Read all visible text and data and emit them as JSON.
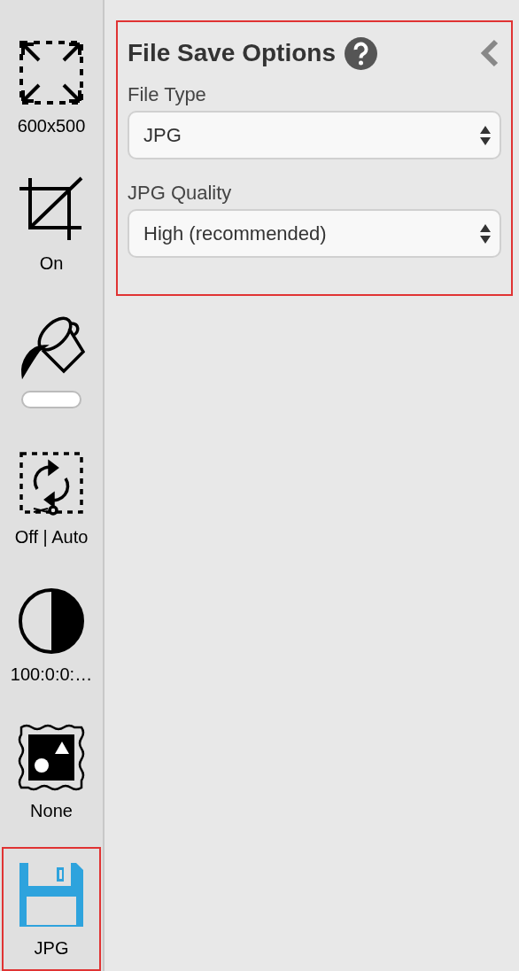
{
  "sidebar": {
    "tools": [
      {
        "kind": "resize",
        "label": "600x500",
        "selected": false
      },
      {
        "kind": "crop",
        "label": "On",
        "selected": false
      },
      {
        "kind": "fill",
        "color": "#ffffff",
        "selected": false
      },
      {
        "kind": "rotate",
        "label": "Off | Auto",
        "selected": false
      },
      {
        "kind": "contrast",
        "label": "100:0:0:…",
        "selected": false
      },
      {
        "kind": "frame",
        "label": "None",
        "selected": false
      },
      {
        "kind": "save",
        "label": "JPG",
        "selected": true
      }
    ]
  },
  "panel": {
    "title": "File Save Options",
    "highlighted": true,
    "fields": [
      {
        "label": "File Type",
        "value": "JPG"
      },
      {
        "label": "JPG Quality",
        "value": "High (recommended)"
      }
    ]
  }
}
